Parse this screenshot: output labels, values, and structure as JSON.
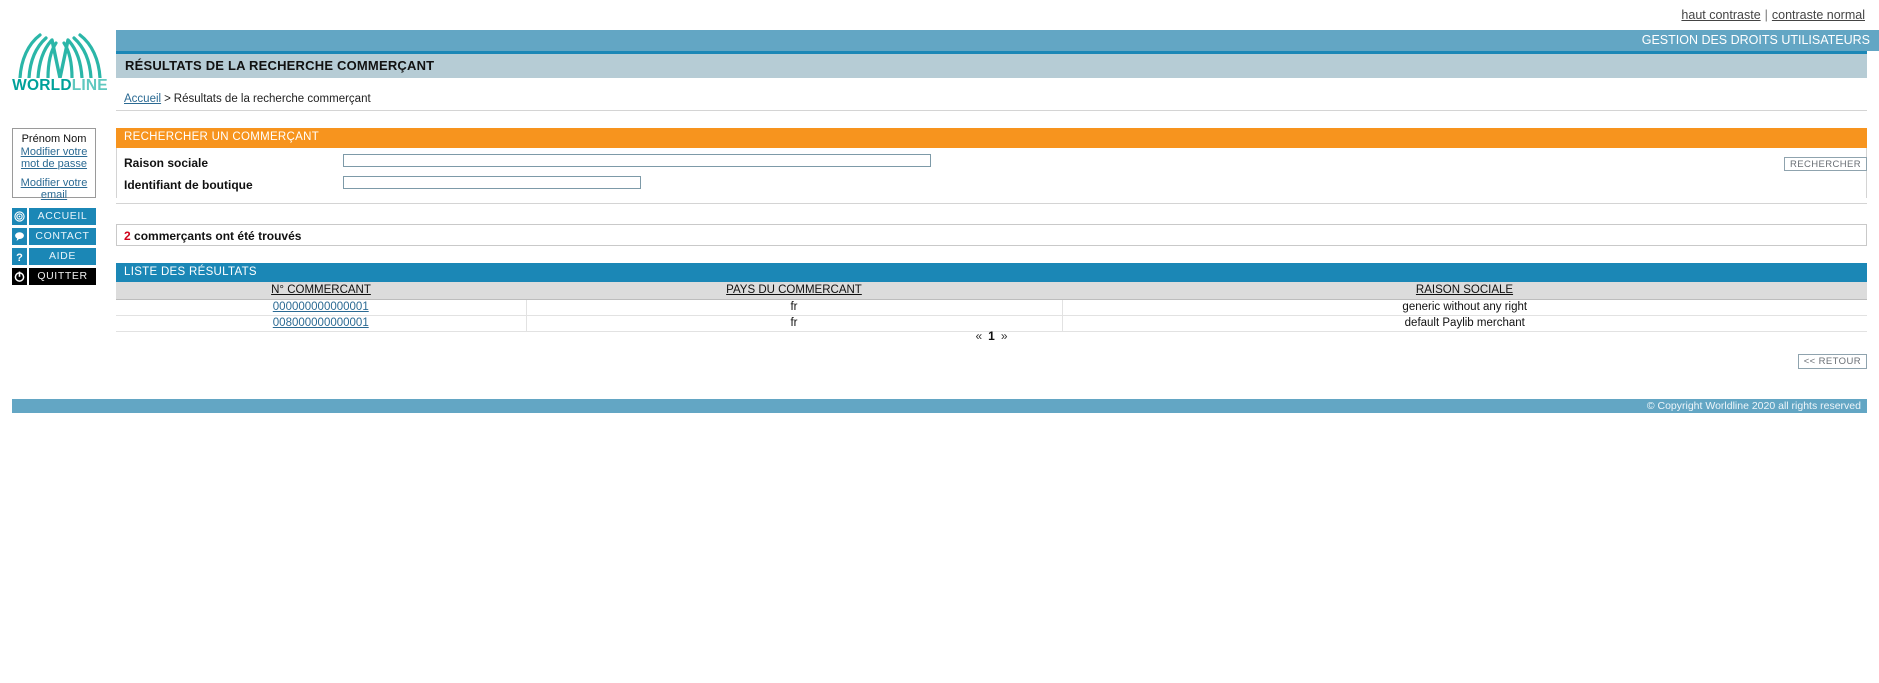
{
  "header": {
    "contrast_high": "haut contraste",
    "contrast_sep": "|",
    "contrast_normal": "contraste normal",
    "tab_label": "GESTION DES DROITS UTILISATEURS",
    "page_title": "RÉSULTATS DE LA RECHERCHE COMMERÇANT"
  },
  "logo": {
    "text_bold": "WORLD",
    "text_light": "LINE",
    "brand_color": "#00a19a"
  },
  "breadcrumb": {
    "home": "Accueil",
    "separator": ">",
    "current": "Résultats de la recherche commerçant"
  },
  "sidebar": {
    "user_name": "Prénom Nom",
    "change_password": "Modifier votre mot de passe",
    "change_email": "Modifier votre email",
    "nav": [
      {
        "label": "ACCUEIL",
        "icon": "target-icon"
      },
      {
        "label": "CONTACT",
        "icon": "speech-bubble-icon"
      },
      {
        "label": "AIDE",
        "icon": "question-mark-icon"
      },
      {
        "label": "QUITTER",
        "icon": "power-icon"
      }
    ]
  },
  "search_panel": {
    "title": "RECHERCHER UN COMMERÇANT",
    "accent_color": "#f7941e",
    "fields": [
      {
        "label": "Raison sociale",
        "value": "",
        "placeholder": ""
      },
      {
        "label": "Identifiant de boutique",
        "value": "",
        "placeholder": ""
      }
    ],
    "submit_label": "RECHERCHER"
  },
  "result_count": {
    "number": "2",
    "text": "commerçants ont été trouvés",
    "number_color": "#d0021b"
  },
  "results": {
    "title": "LISTE DES RÉSULTATS",
    "accent_color": "#1b87b6",
    "columns": [
      "N° COMMERCANT",
      "PAYS DU COMMERCANT",
      "RAISON SOCIALE"
    ],
    "rows": [
      {
        "merchant_id": "000000000000001",
        "country": "fr",
        "company_name": "generic without any right"
      },
      {
        "merchant_id": "008000000000001",
        "country": "fr",
        "company_name": "default Paylib merchant"
      }
    ]
  },
  "pagination": {
    "prev": "«",
    "current_page": "1",
    "next": "»"
  },
  "actions": {
    "back_label": "<< RETOUR"
  },
  "footer": {
    "copyright": "© Copyright Worldline 2020 all rights reserved"
  }
}
